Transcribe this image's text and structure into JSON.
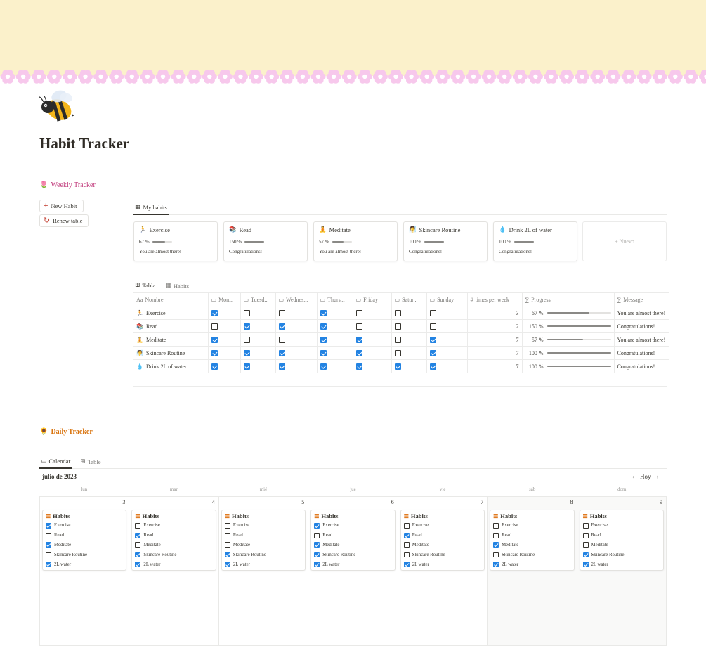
{
  "page": {
    "icon": "bee-icon",
    "title": "Habit Tracker",
    "divider_color": "#f4c6d7",
    "cover_color": "#fbf1cb",
    "flower_color": "#f7c8ec"
  },
  "weekly": {
    "title": "Weekly Tracker",
    "title_icon": "tulip-icon",
    "title_color": "#c0397b",
    "buttons": {
      "new_habit": "New Habit",
      "renew_table": "Renew table"
    },
    "gallery_tab": "My habits",
    "new_card_label": "+ Nuevo",
    "cards": [
      {
        "icon": "🏃",
        "name": "Exercise",
        "progress_label": "67 %",
        "progress": 0.67,
        "message": "You are almost there!"
      },
      {
        "icon": "📚",
        "name": "Read",
        "progress_label": "150 %",
        "progress": 1.0,
        "message": "Congratulations!"
      },
      {
        "icon": "🧘",
        "name": "Meditate",
        "progress_label": "57 %",
        "progress": 0.57,
        "message": "You are almost there!"
      },
      {
        "icon": "🧖",
        "name": "Skincare Routine",
        "progress_label": "100 %",
        "progress": 1.0,
        "message": "Congratulations!"
      },
      {
        "icon": "💧",
        "name": "Drink 2L of water",
        "progress_label": "100 %",
        "progress": 1.0,
        "message": "Congratulations!"
      }
    ],
    "table_tabs": [
      "Tabla",
      "Habits"
    ],
    "columns": [
      "Nombre",
      "Mon...",
      "Tuesd...",
      "Wednes...",
      "Thurs...",
      "Friday",
      "Satur...",
      "Sunday",
      "times per week",
      "Progress",
      "Message"
    ],
    "rows": [
      {
        "icon": "🏃",
        "name": "Exercise",
        "days": [
          true,
          false,
          false,
          true,
          false,
          false,
          false
        ],
        "times": "3",
        "progress_label": "67 %",
        "progress": 0.67,
        "message": "You are almost there!"
      },
      {
        "icon": "📚",
        "name": "Read",
        "days": [
          false,
          true,
          true,
          true,
          false,
          false,
          false
        ],
        "times": "2",
        "progress_label": "150 %",
        "progress": 1.0,
        "message": "Congratulations!"
      },
      {
        "icon": "🧘",
        "name": "Meditate",
        "days": [
          true,
          false,
          false,
          true,
          true,
          false,
          true
        ],
        "times": "7",
        "progress_label": "57 %",
        "progress": 0.57,
        "message": "You are almost there!"
      },
      {
        "icon": "🧖",
        "name": "Skincare Routine",
        "days": [
          true,
          true,
          true,
          true,
          true,
          false,
          true
        ],
        "times": "7",
        "progress_label": "100 %",
        "progress": 1.0,
        "message": "Congratulations!"
      },
      {
        "icon": "💧",
        "name": "Drink 2L of water",
        "days": [
          true,
          true,
          true,
          true,
          true,
          true,
          true
        ],
        "times": "7",
        "progress_label": "100 %",
        "progress": 1.0,
        "message": "Congratulations!"
      }
    ]
  },
  "daily": {
    "title": "Daily Tracker",
    "title_icon": "sunflower-icon",
    "title_color": "#d9730d",
    "divider_color": "#f5b66b",
    "tabs": [
      "Calendar",
      "Table"
    ],
    "month": "julio de 2023",
    "today_label": "Hoy",
    "weekdays": [
      "lun",
      "mar",
      "mié",
      "jue",
      "vie",
      "sáb",
      "dom"
    ],
    "card_title": "Habits",
    "item_labels": [
      "Exercise",
      "Read",
      "Meditate",
      "Skincare Routine",
      "2L water"
    ],
    "days": [
      {
        "num": "3",
        "checks": [
          true,
          false,
          true,
          false,
          true
        ]
      },
      {
        "num": "4",
        "checks": [
          false,
          true,
          false,
          true,
          true
        ]
      },
      {
        "num": "5",
        "checks": [
          false,
          false,
          false,
          true,
          true
        ]
      },
      {
        "num": "6",
        "checks": [
          true,
          false,
          true,
          true,
          true
        ]
      },
      {
        "num": "7",
        "checks": [
          false,
          true,
          false,
          false,
          true
        ]
      },
      {
        "num": "8",
        "checks": [
          false,
          false,
          true,
          false,
          true
        ]
      },
      {
        "num": "9",
        "checks": [
          false,
          false,
          false,
          true,
          true
        ]
      }
    ]
  }
}
